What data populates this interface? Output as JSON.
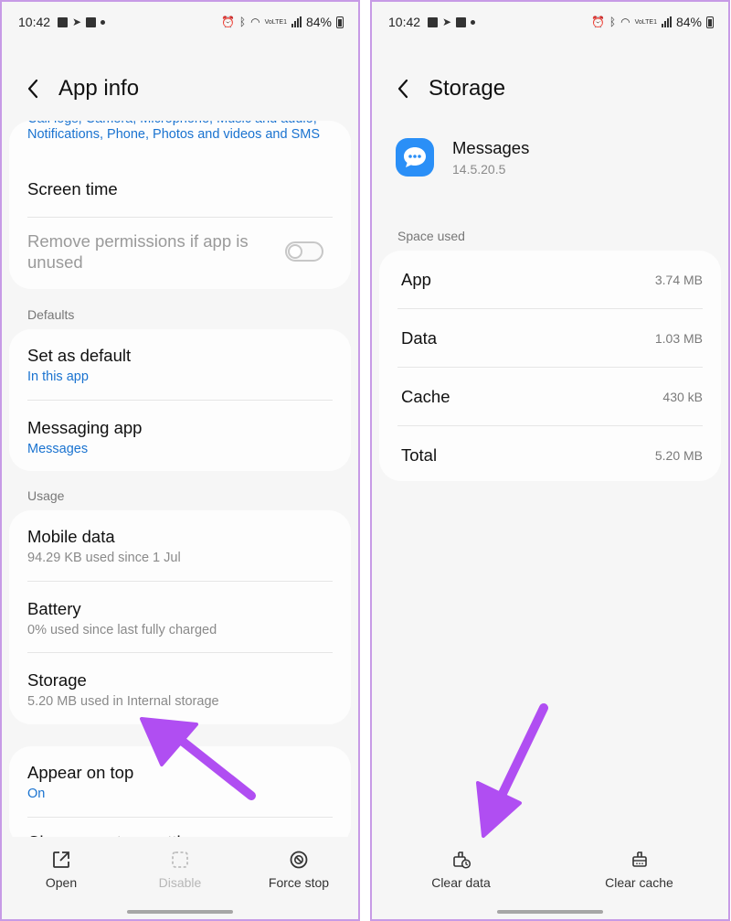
{
  "status_bar": {
    "time": "10:42",
    "battery": "84%",
    "network": "VoLTE1"
  },
  "left": {
    "title": "App info",
    "permissions_text": "Call logs, Camera, Microphone, Music and audio, Notifications, Phone, Photos and videos and SMS",
    "screen_time": "Screen time",
    "remove_permissions": "Remove permissions if app is unused",
    "defaults_label": "Defaults",
    "set_default": {
      "title": "Set as default",
      "sub": "In this app"
    },
    "messaging_app": {
      "title": "Messaging app",
      "sub": "Messages"
    },
    "usage_label": "Usage",
    "mobile_data": {
      "title": "Mobile data",
      "sub": "94.29 KB used since 1 Jul"
    },
    "battery": {
      "title": "Battery",
      "sub": "0% used since last fully charged"
    },
    "storage": {
      "title": "Storage",
      "sub": "5.20 MB used in Internal storage"
    },
    "appear_on_top": {
      "title": "Appear on top",
      "sub": "On"
    },
    "change_settings": "Change system settings",
    "bottom": {
      "open": "Open",
      "disable": "Disable",
      "force_stop": "Force stop"
    }
  },
  "right": {
    "title": "Storage",
    "app_name": "Messages",
    "app_version": "14.5.20.5",
    "space_used_label": "Space used",
    "rows": [
      {
        "label": "App",
        "value": "3.74 MB"
      },
      {
        "label": "Data",
        "value": "1.03 MB"
      },
      {
        "label": "Cache",
        "value": "430 kB"
      },
      {
        "label": "Total",
        "value": "5.20 MB"
      }
    ],
    "bottom": {
      "clear_data": "Clear data",
      "clear_cache": "Clear cache"
    }
  },
  "colors": {
    "accent": "#1a73d0",
    "arrow": "#b04ef2",
    "app_icon": "#2a8ff7",
    "frame": "#c79be6"
  },
  "icons": [
    "back-arrow-icon",
    "open-icon",
    "disable-icon",
    "force-stop-icon",
    "clear-data-icon",
    "clear-cache-icon",
    "messages-app-icon"
  ]
}
